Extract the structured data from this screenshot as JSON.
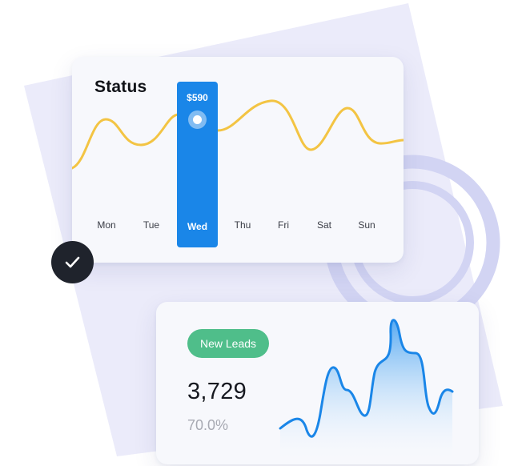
{
  "status_card": {
    "title": "Status",
    "selected": {
      "day": "Wed",
      "value": "$590"
    },
    "days": [
      "Mon",
      "Tue",
      "Wed",
      "Thu",
      "Fri",
      "Sat",
      "Sun"
    ]
  },
  "leads_card": {
    "badge": "New Leads",
    "count": "3,729",
    "percent": "70.0%"
  },
  "colors": {
    "accent_blue": "#1a86e8",
    "wave_yellow": "#f3c443",
    "badge_green": "#4fbe8a",
    "badge_dark": "#1f232c",
    "backdrop_lavender": "#e9e9f8",
    "ring": "#cfd1f2"
  },
  "icons": {
    "status_badge": "check-icon"
  }
}
